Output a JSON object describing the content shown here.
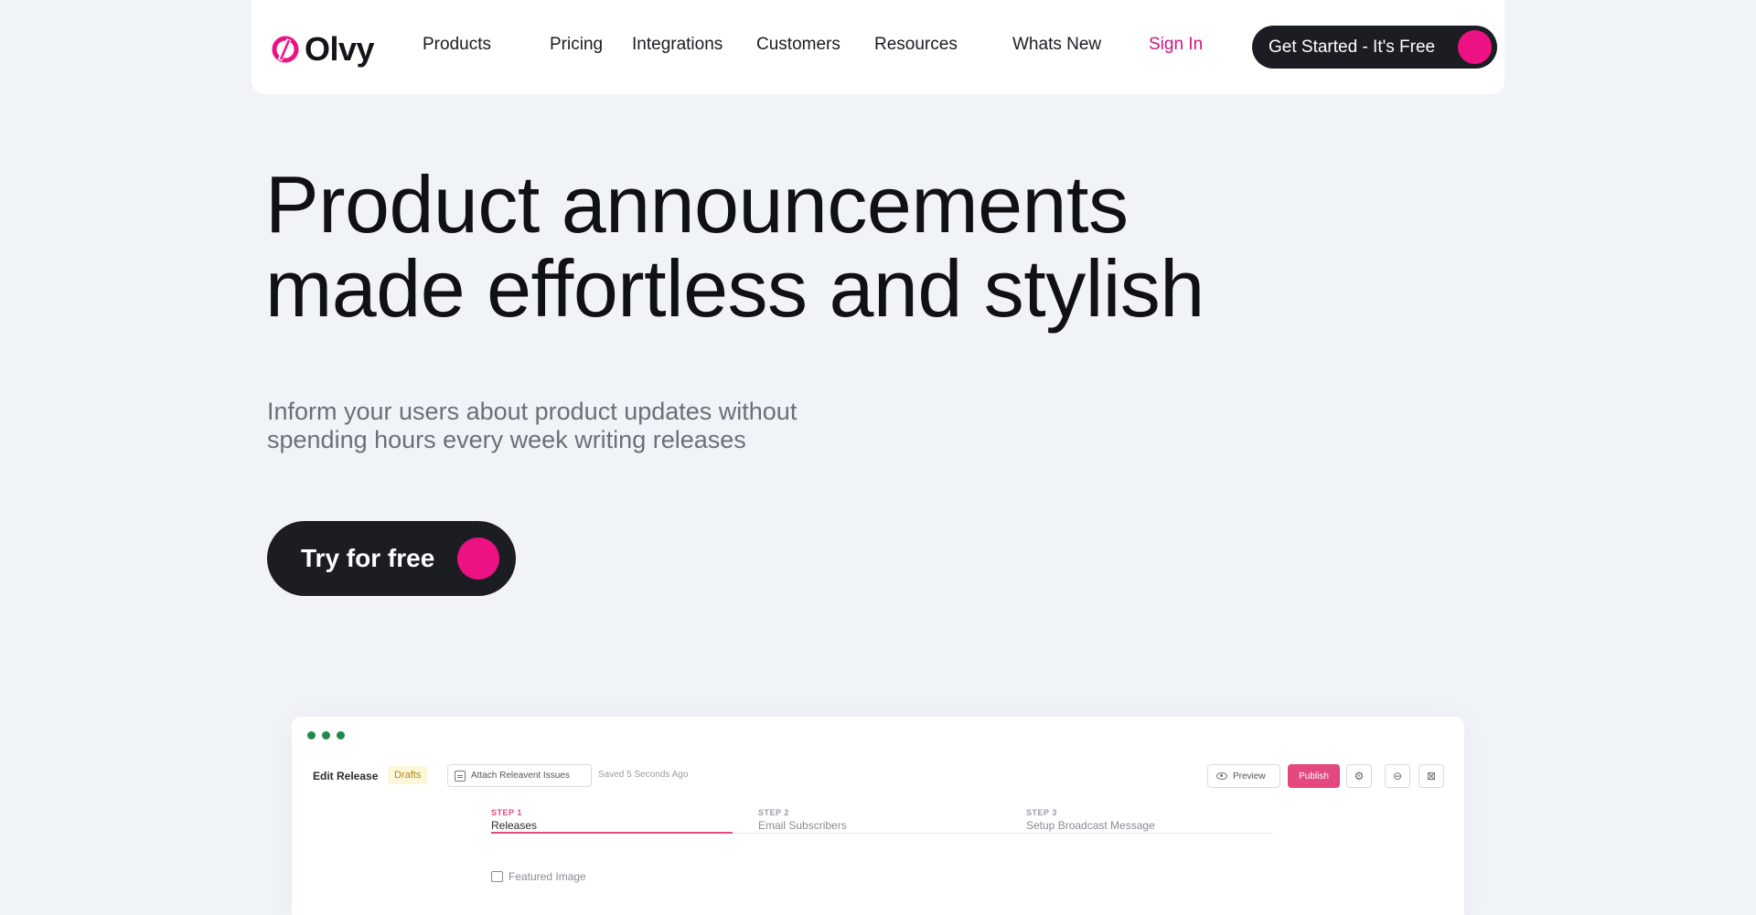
{
  "brand": {
    "name": "Olvy",
    "accent": "#ec1283",
    "dark": "#1c1d22"
  },
  "nav": {
    "items": [
      {
        "label": "Products"
      },
      {
        "label": "Pricing"
      },
      {
        "label": "Integrations"
      },
      {
        "label": "Customers"
      },
      {
        "label": "Resources"
      },
      {
        "label": "Whats New"
      }
    ],
    "signin": "Sign In",
    "cta": "Get Started - It's Free"
  },
  "hero": {
    "title_line1": "Product announcements",
    "title_line2": "made effortless and stylish",
    "subtitle_line1": "Inform your users about product updates without",
    "subtitle_line2": "spending hours every week writing releases",
    "cta": "Try for free"
  },
  "app_preview": {
    "title": "Edit Release",
    "badge": "Drafts",
    "attach": "Attach Releavent Issues",
    "saved": "Saved 5 Seconds Ago",
    "preview": "Preview",
    "publish": "Publish",
    "steps": [
      {
        "label": "STEP 1",
        "name": "Releases"
      },
      {
        "label": "STEP 2",
        "name": "Email Subscribers"
      },
      {
        "label": "STEP 3",
        "name": "Setup Broadcast Message"
      }
    ],
    "featured_image": "Featured Image"
  }
}
